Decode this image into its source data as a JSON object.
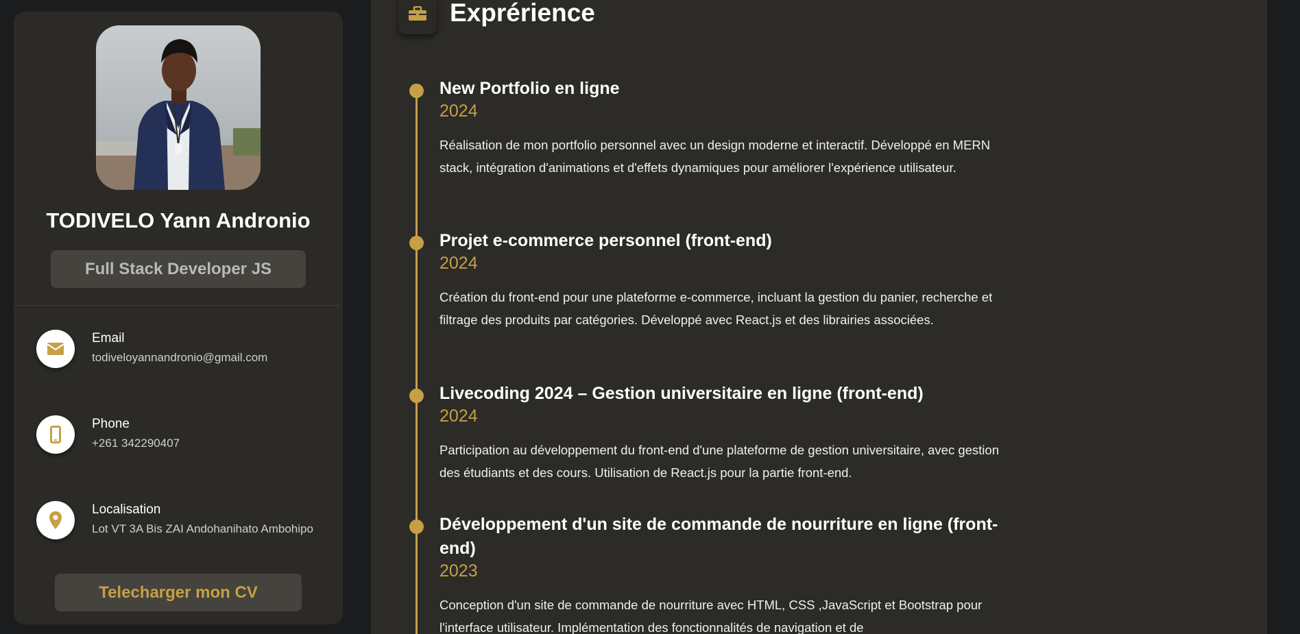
{
  "profile": {
    "name": "TODIVELO Yann Andronio",
    "role": "Full Stack Developer JS"
  },
  "contacts": [
    {
      "icon": "envelope-icon",
      "title": "Email",
      "value": "todiveloyannandronio@gmail.com"
    },
    {
      "icon": "phone-icon",
      "title": "Phone",
      "value": "+261 342290407"
    },
    {
      "icon": "location-pin-icon",
      "title": "Localisation",
      "value": "Lot VT 3A Bis ZAI Andohanihato Ambohipo"
    }
  ],
  "cv_button": {
    "label": "Telecharger mon CV"
  },
  "experience": {
    "icon": "briefcase-icon",
    "title": "Exprérience",
    "items": [
      {
        "title": "New Portfolio en ligne",
        "year": "2024",
        "description": "Réalisation de mon portfolio personnel avec un design moderne et interactif. Développé en MERN stack, intégration d'animations et d'effets dynamiques pour améliorer l'expérience utilisateur."
      },
      {
        "title": "Projet e-commerce personnel (front-end)",
        "year": "2024",
        "description": "Création du front-end pour une plateforme e-commerce, incluant la gestion du panier, recherche et filtrage des produits par catégories. Développé avec React.js et des librairies associées."
      },
      {
        "title": "Livecoding 2024 – Gestion universitaire en ligne (front-end)",
        "year": "2024",
        "description": "Participation au développement du front-end d'une plateforme de gestion universitaire, avec gestion des étudiants et des cours. Utilisation de React.js pour la partie front-end."
      },
      {
        "title": "Développement d'un site de commande de nourriture en ligne (front-end)",
        "year": "2023",
        "description": "Conception d'un site de commande de nourriture avec HTML, CSS ,JavaScript et Bootstrap pour l'interface utilisateur. Implémentation des fonctionnalités de navigation et de"
      }
    ]
  },
  "colors": {
    "accent": "#c6a046",
    "sidebar_bg": "#2b2a26",
    "main_bg": "#2c2b28",
    "page_bg": "#1b1c1e"
  }
}
